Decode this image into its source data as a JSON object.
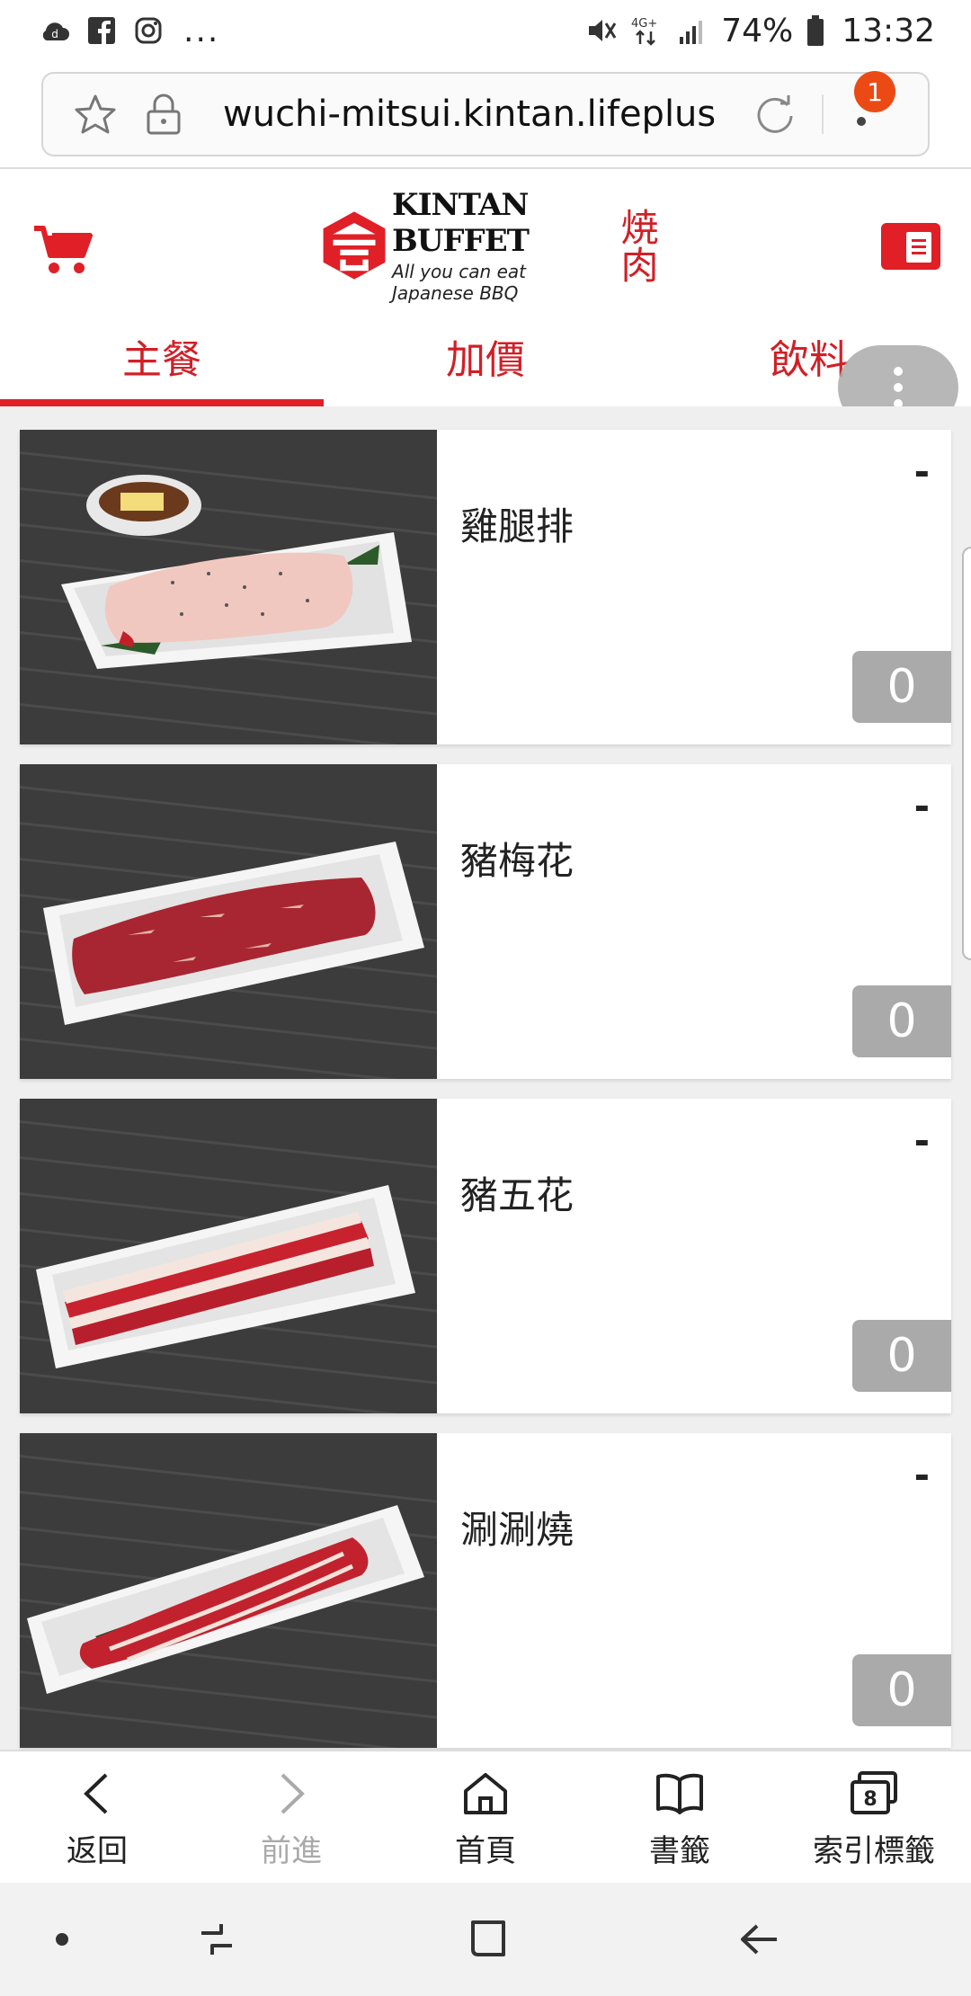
{
  "status_bar": {
    "notification_icons": [
      "cloud-icon",
      "facebook-icon",
      "instagram-icon"
    ],
    "more": "...",
    "network": "4G+",
    "battery": "74%",
    "time": "13:32"
  },
  "browser": {
    "url": "wuchi-mitsui.kintan.lifeplus.tw",
    "notification_count": "1"
  },
  "header": {
    "logo_title": "KINTAN BUFFET",
    "logo_subtitle": "All you can eat Japanese BBQ",
    "logo_kanji": "焼肉"
  },
  "tabs": [
    {
      "label": "主餐",
      "active": true
    },
    {
      "label": "加價",
      "active": false
    },
    {
      "label": "飲料",
      "active": false
    }
  ],
  "items": [
    {
      "name": "雞腿排",
      "minus": "-",
      "qty": "0"
    },
    {
      "name": "豬梅花",
      "minus": "-",
      "qty": "0"
    },
    {
      "name": "豬五花",
      "minus": "-",
      "qty": "0"
    },
    {
      "name": "涮涮燒",
      "minus": "-",
      "qty": "0"
    }
  ],
  "bottom_toolbar": {
    "back": "返回",
    "forward": "前進",
    "home": "首頁",
    "bookmarks": "書籤",
    "tabs": "索引標籤",
    "tab_count": "8"
  },
  "colors": {
    "brand_red": "#e01f26",
    "qty_gray": "#aaaaaa",
    "badge_orange": "#ec4a14"
  }
}
